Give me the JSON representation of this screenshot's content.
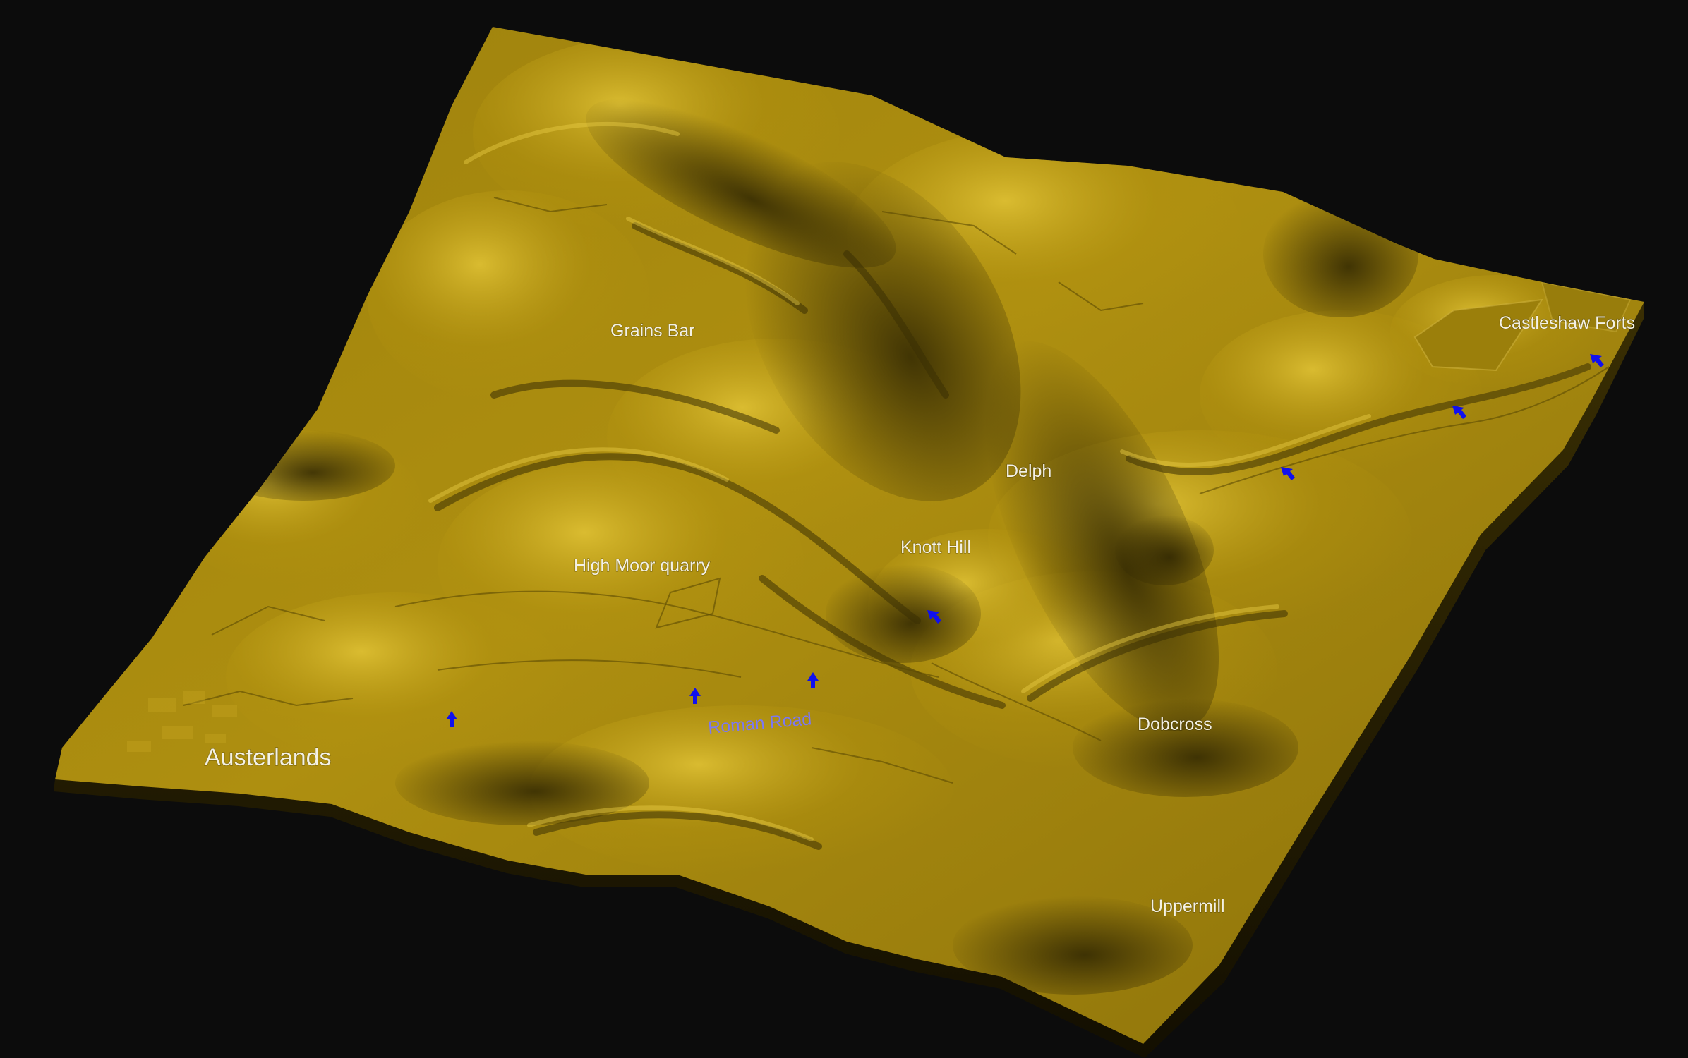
{
  "map": {
    "colors": {
      "background": "#0c0c0c",
      "terrain": "#a98b0e",
      "terrain_light": "#d7b72a",
      "terrain_shadow": "#3d3202",
      "arrow": "#1010ee",
      "label": "#f4f1e4",
      "road_label": "#7c78f2"
    },
    "places": {
      "austerlands": "Austerlands",
      "grains_bar": "Grains Bar",
      "high_moor_quarry": "High Moor quarry",
      "delph": "Delph",
      "knott_hill": "Knott Hill",
      "dobcross": "Dobcross",
      "uppermill": "Uppermill",
      "castleshaw_forts": "Castleshaw Forts"
    },
    "route_label": "Roman Road",
    "route_marker_icon": "blue-arrow-icon"
  }
}
